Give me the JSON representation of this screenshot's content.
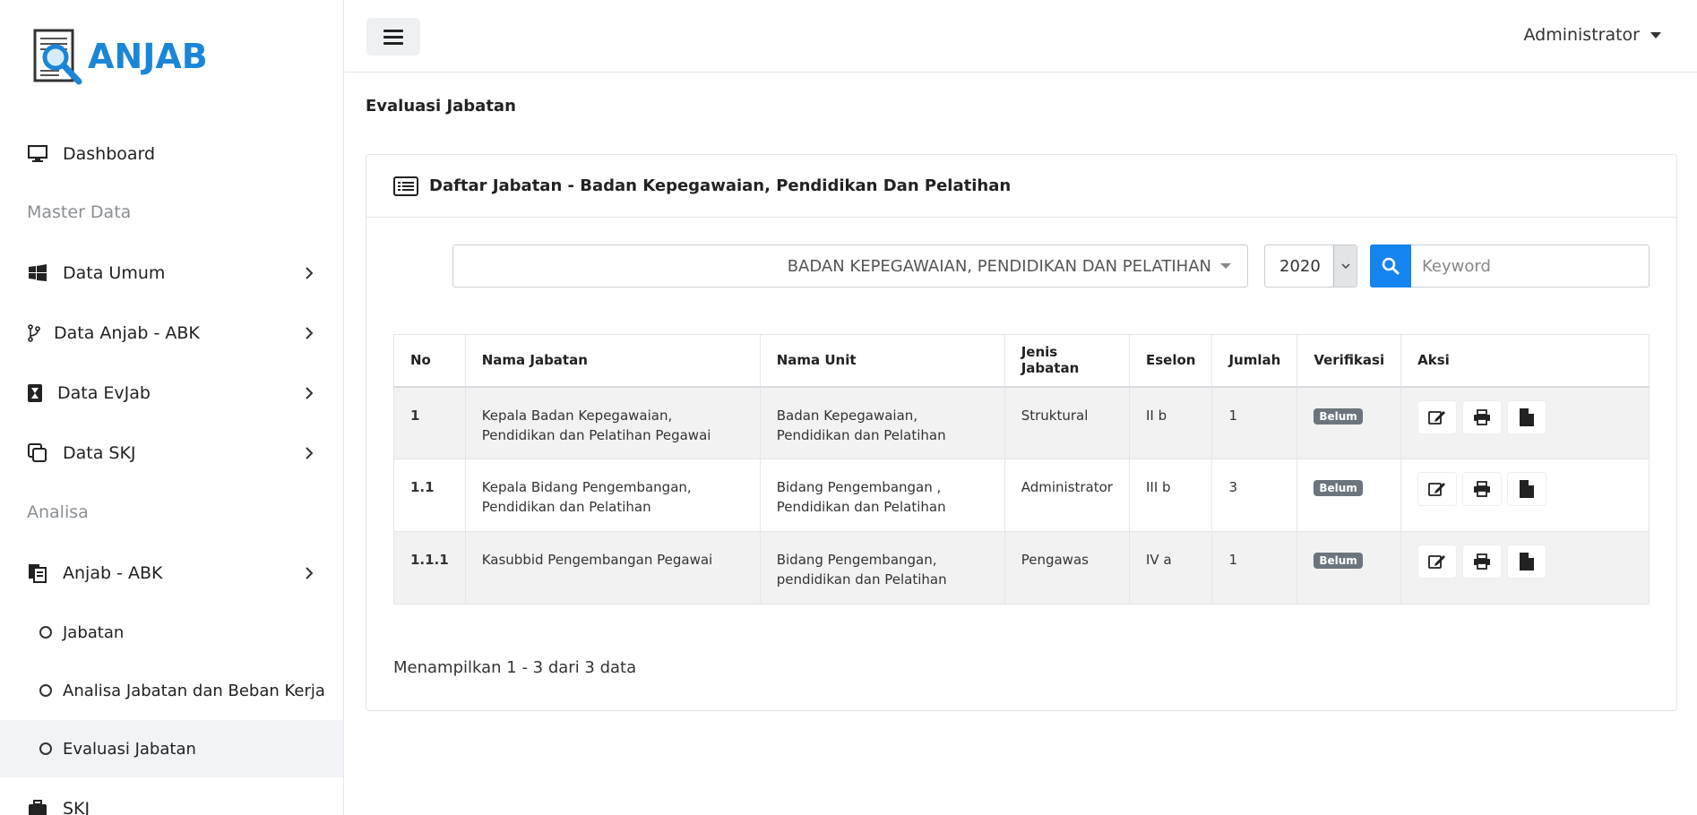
{
  "app": {
    "logo_text": "ANJAB"
  },
  "sidebar": {
    "dashboard": "Dashboard",
    "header_master": "Master Data",
    "data_umum": "Data Umum",
    "data_anjab": "Data Anjab - ABK",
    "data_evjab": "Data EvJab",
    "data_skj": "Data SKJ",
    "header_analisa": "Analisa",
    "anjab_abk": "Anjab - ABK",
    "sub_items": [
      "Jabatan",
      "Analisa Jabatan dan Beban Kerja",
      "Evaluasi Jabatan"
    ],
    "skj": "SKJ"
  },
  "topbar": {
    "user": "Administrator"
  },
  "page": {
    "title": "Evaluasi Jabatan"
  },
  "card": {
    "title": "Daftar Jabatan - Badan Kepegawaian, Pendidikan Dan Pelatihan",
    "unit_selected": "BADAN KEPEGAWAIAN, PENDIDIKAN DAN PELATIHAN",
    "year_selected": "2020",
    "search_placeholder": "Keyword"
  },
  "table": {
    "headers": [
      "No",
      "Nama Jabatan",
      "Nama Unit",
      "Jenis Jabatan",
      "Eselon",
      "Jumlah",
      "Verifikasi",
      "Aksi"
    ],
    "rows": [
      {
        "no": "1",
        "nama": "Kepala Badan Kepegawaian, Pendidikan dan Pelatihan Pegawai",
        "unit": "Badan Kepegawaian, Pendidikan dan Pelatihan",
        "jenis": "Struktural",
        "eselon": "II b",
        "jumlah": "1",
        "verifikasi": "Belum"
      },
      {
        "no": "1.1",
        "nama": "Kepala Bidang Pengembangan, Pendidikan dan Pelatihan",
        "unit": "Bidang Pengembangan , Pendidikan dan Pelatihan",
        "jenis": "Administrator",
        "eselon": "III b",
        "jumlah": "3",
        "verifikasi": "Belum"
      },
      {
        "no": "1.1.1",
        "nama": "Kasubbid Pengembangan Pegawai",
        "unit": "Bidang Pengembangan, pendidikan dan Pelatihan",
        "jenis": "Pengawas",
        "eselon": "IV a",
        "jumlah": "1",
        "verifikasi": "Belum"
      }
    ]
  },
  "footer": {
    "summary": "Menampilkan 1 - 3 dari 3 data"
  },
  "icons": {
    "edit": "edit-icon",
    "print": "print-icon",
    "document": "document-icon",
    "search": "search-icon",
    "menu": "hamburger-icon"
  },
  "colors": {
    "brand": "#1a86d8",
    "primary": "#1584f0",
    "badge": "#6c757d",
    "active_bg": "#f1f3f6"
  }
}
